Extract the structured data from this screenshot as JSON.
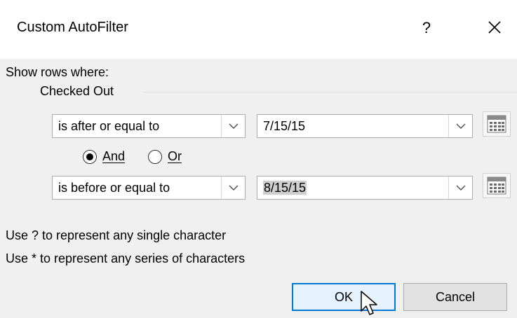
{
  "dialog": {
    "title": "Custom AutoFilter",
    "help_label": "?",
    "close_icon": "close-icon"
  },
  "filter": {
    "show_rows_label": "Show rows where:",
    "group_label": "Checked Out",
    "condition1": {
      "operator": "is after or equal to",
      "value": "7/15/15"
    },
    "logic": {
      "and_label": "And",
      "or_label": "Or",
      "selected": "And"
    },
    "condition2": {
      "operator": "is before or equal to",
      "value": "8/15/15"
    },
    "calendar_icon": "calendar-icon"
  },
  "hints": {
    "line1": "Use ? to represent any single character",
    "line2": "Use * to represent any series of characters"
  },
  "buttons": {
    "ok_label": "OK",
    "cancel_label": "Cancel"
  },
  "colors": {
    "ok_border": "#0078d7",
    "ok_bg": "#e5f1fb",
    "client_bg": "#f0f0f0"
  }
}
